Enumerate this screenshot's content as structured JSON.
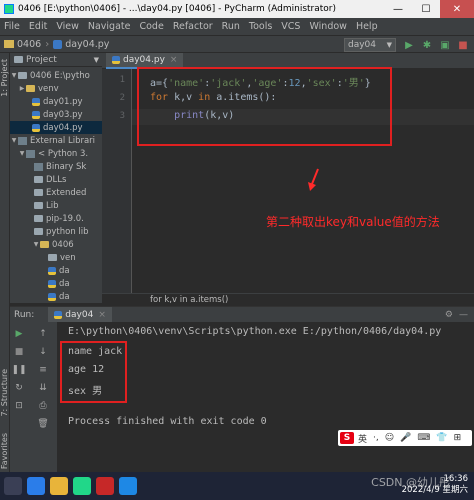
{
  "window": {
    "title": "0406 [E:\\python\\0406] - ...\\day04.py [0406] - PyCharm (Administrator)",
    "minimize": "—",
    "maximize": "☐",
    "close": "✕"
  },
  "menu": [
    "File",
    "Edit",
    "View",
    "Navigate",
    "Code",
    "Refactor",
    "Run",
    "Tools",
    "VCS",
    "Window",
    "Help"
  ],
  "navbar": {
    "project": "0406",
    "file": "day04.py",
    "run_config": "day04",
    "run_icon": "run-icon",
    "debug_icon": "debug-icon"
  },
  "left_tabs": {
    "project": "1: Project",
    "structure": "7: Structure",
    "favorites": "2: Favorites"
  },
  "project_panel": {
    "title": "Project",
    "tree": [
      {
        "label": "0406  E:\\pytho",
        "icon": "folder",
        "open": true
      },
      {
        "label": "venv",
        "icon": "folder-yellow",
        "open": false
      },
      {
        "label": "day01.py",
        "icon": "py"
      },
      {
        "label": "day03.py",
        "icon": "py"
      },
      {
        "label": "day04.py",
        "icon": "py"
      },
      {
        "label": "External Librari",
        "icon": "lib",
        "open": true
      },
      {
        "label": "< Python 3.",
        "icon": "lib",
        "open": true
      },
      {
        "label": "Binary Sk",
        "icon": "lib"
      },
      {
        "label": "DLLs",
        "icon": "folder"
      },
      {
        "label": "Extended",
        "icon": "folder"
      },
      {
        "label": "Lib",
        "icon": "folder"
      },
      {
        "label": "pip-19.0.",
        "icon": "folder"
      },
      {
        "label": "python lib",
        "icon": "folder"
      },
      {
        "label": "0406",
        "icon": "folder-yellow",
        "open": true
      },
      {
        "label": "ven",
        "icon": "folder"
      },
      {
        "label": "da",
        "icon": "py"
      },
      {
        "label": "da",
        "icon": "py"
      },
      {
        "label": "da",
        "icon": "py"
      }
    ]
  },
  "editor": {
    "tab": "day04.py",
    "line_numbers": [
      "1",
      "2",
      "3"
    ],
    "lines": [
      "a={'name':'jack','age':12,'sex':'男'}",
      "for k,v in a.items():",
      "    print(k,v)"
    ],
    "breadcrumb": "for k,v in a.items()"
  },
  "annotation": {
    "text": "第二种取出key和value值的方法",
    "color": "#ff2a2a"
  },
  "run_panel": {
    "label": "Run:",
    "tab": "day04",
    "command": "E:\\python\\0406\\venv\\Scripts\\python.exe E:/python/0406/day04.py",
    "output": [
      "name jack",
      "age 12",
      "sex 男"
    ],
    "exit": "Process finished with exit code 0"
  },
  "ime": {
    "logo": "S",
    "mode": "英",
    "items": [
      "·,",
      "☺",
      "🎤",
      "⌨",
      "👕",
      "⊞"
    ]
  },
  "taskbar": {
    "time": "16:36",
    "date": "2022/4/9 星期六",
    "watermark": "CSDN @幼儿彤"
  },
  "colors": {
    "accent": "#4a88c7",
    "annotation_red": "#e02020",
    "editor_bg": "#2b2b2b",
    "panel_bg": "#3c3f41"
  }
}
